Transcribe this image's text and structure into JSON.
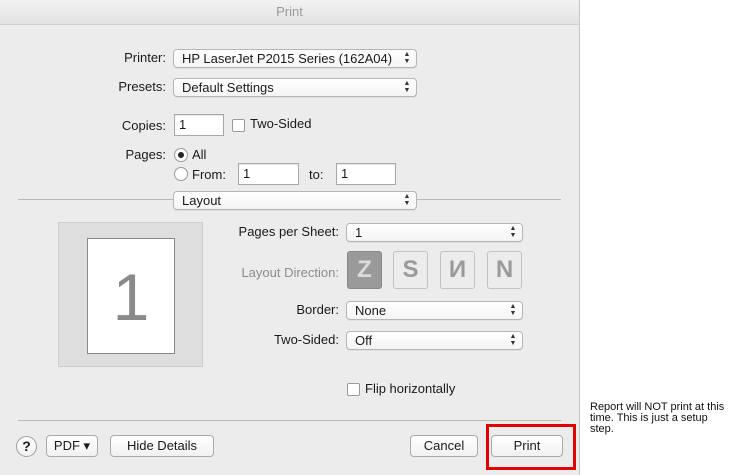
{
  "window": {
    "title": "Print"
  },
  "printer": {
    "label": "Printer:",
    "value": "HP LaserJet P2015 Series (162A04)"
  },
  "presets": {
    "label": "Presets:",
    "value": "Default Settings"
  },
  "copies": {
    "label": "Copies:",
    "value": "1",
    "two_sided_label": "Two-Sided"
  },
  "pages": {
    "label": "Pages:",
    "all_label": "All",
    "from_label": "From:",
    "from_value": "1",
    "to_label": "to:",
    "to_value": "1"
  },
  "section": {
    "value": "Layout"
  },
  "layout": {
    "pages_per_sheet_label": "Pages per Sheet:",
    "pages_per_sheet_value": "1",
    "direction_label": "Layout Direction:",
    "directions": [
      "Z",
      "S",
      "И",
      "N"
    ],
    "border_label": "Border:",
    "border_value": "None",
    "two_sided_label": "Two-Sided:",
    "two_sided_value": "Off",
    "flip_label": "Flip horizontally"
  },
  "preview": {
    "page_number": "1"
  },
  "footer": {
    "help": "?",
    "pdf_label": "PDF ▾",
    "hide_details_label": "Hide Details",
    "cancel_label": "Cancel",
    "print_label": "Print"
  },
  "annotation": {
    "text": "Report will NOT print at this time. This is just a setup step.",
    "highlight_color": "#e00000"
  }
}
